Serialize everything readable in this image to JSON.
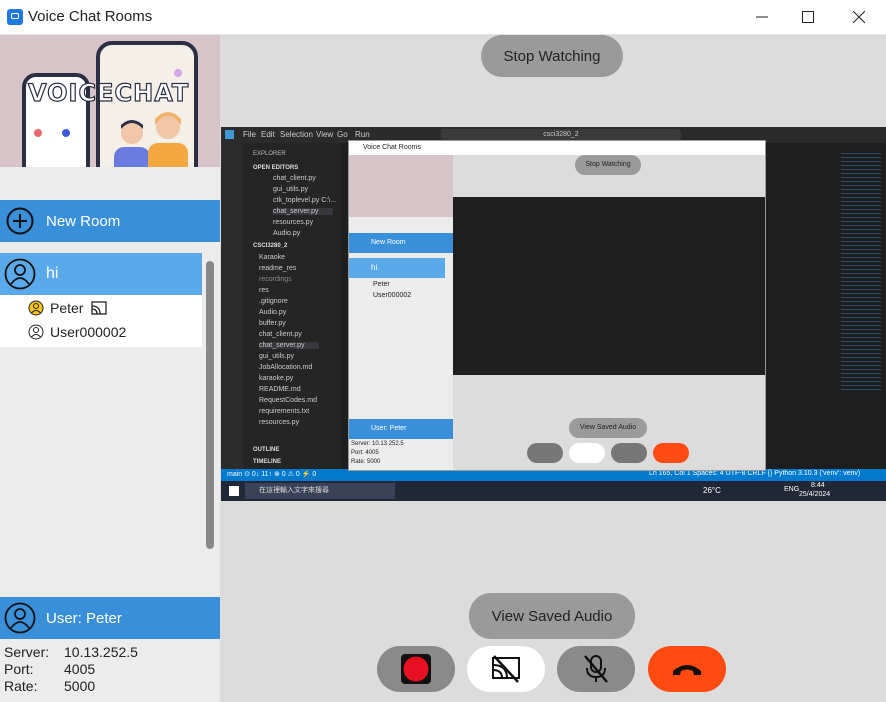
{
  "window": {
    "title": "Voice Chat Rooms"
  },
  "banner": {
    "logo_text": "VOICECHAT"
  },
  "sidebar": {
    "new_room_label": "New Room",
    "room": {
      "name": "hi",
      "members": [
        {
          "name": "Peter",
          "icon": "user-speaking-icon",
          "streaming": true
        },
        {
          "name": "User000002",
          "icon": "user-icon",
          "streaming": false
        }
      ]
    },
    "user": {
      "label": "User: Peter"
    },
    "info": [
      {
        "key": "Server:",
        "value": "10.13.252.5"
      },
      {
        "key": "Port:",
        "value": "4005"
      },
      {
        "key": "Rate:",
        "value": "5000"
      }
    ]
  },
  "main": {
    "stop_watching_label": "Stop Watching",
    "view_saved_audio_label": "View Saved Audio",
    "controls": [
      {
        "name": "record-button",
        "icon": "record-icon",
        "color": "#e81123"
      },
      {
        "name": "screen-share-button",
        "icon": "screen-share-off-icon"
      },
      {
        "name": "mic-button",
        "icon": "mic-muted-icon"
      },
      {
        "name": "hang-up-button",
        "icon": "phone-hangup-icon",
        "color": "#ff4a12"
      }
    ]
  },
  "shared_screen": {
    "menu": [
      "File",
      "Edit",
      "Selection",
      "View",
      "Go",
      "Run"
    ],
    "search": "csci3280_2",
    "explorer_title": "EXPLORER",
    "open_editors_title": "OPEN EDITORS",
    "open_editors": [
      "chat_client.py",
      "gui_utils.py",
      "ctk_toplevel.py C:\\...",
      "chat_server.py",
      "resources.py",
      "Audio.py"
    ],
    "project_title": "CSCI3280_2",
    "files": [
      "Karaoke",
      "readme_res",
      "recordings",
      "res",
      ".gitignore",
      "Audio.py",
      "buffer.py",
      "chat_client.py",
      "chat_server.py",
      "gui_utils.py",
      "JobAllocation.md",
      "karaoke.py",
      "README.md",
      "RequestCodes.md",
      "requirements.txt",
      "resources.py"
    ],
    "outline_label": "OUTLINE",
    "timeline_label": "TIMELINE",
    "status_left": "main  ⊙ 0↓ 11↑   ⊗ 0 ⚠ 0   ⚡ 0",
    "status_right": "Ln 165, Col 1   Spaces: 4   UTF-8   CRLF   {} Python   3.10.3 ('venv': venv)",
    "taskbar_search": "在這裡輸入文字來搜尋",
    "taskbar_weather": "26°C",
    "taskbar_lang": "ENG",
    "taskbar_time": "8:44",
    "taskbar_date": "25/4/2024",
    "inner_window_title": "Voice Chat Rooms",
    "inner": {
      "stop_watching": "Stop Watching",
      "new_room": "New Room",
      "room": "hi",
      "members": [
        "Peter",
        "User000002"
      ],
      "user": "User: Peter",
      "info": [
        "Server:  10.13.252.5",
        "Port:  4005",
        "Rate:  5000"
      ],
      "view_saved_audio": "View Saved Audio"
    }
  }
}
